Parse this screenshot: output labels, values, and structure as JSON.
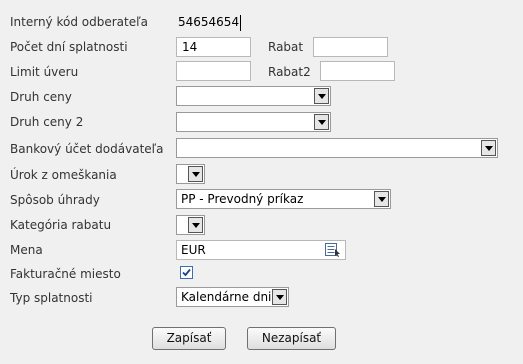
{
  "form": {
    "internal_code": {
      "label": "Interný kód odberateľa",
      "value": "54654654"
    },
    "due_days": {
      "label": "Počet dní splatnosti",
      "value": "14"
    },
    "discount": {
      "label": "Rabat",
      "value": ""
    },
    "credit_limit": {
      "label": "Limit úveru",
      "value": ""
    },
    "discount2": {
      "label": "Rabat2",
      "value": ""
    },
    "price_type": {
      "label": "Druh ceny",
      "value": ""
    },
    "price_type2": {
      "label": "Druh ceny 2",
      "value": ""
    },
    "supplier_account": {
      "label": "Bankový účet dodávateľa",
      "value": ""
    },
    "late_interest": {
      "label": "Úrok z omeškania",
      "value": ""
    },
    "payment_method": {
      "label": "Spôsob úhrady",
      "value": "PP - Prevodný príkaz"
    },
    "discount_category": {
      "label": "Kategória rabatu",
      "value": ""
    },
    "currency": {
      "label": "Mena",
      "value": "EUR",
      "icon": "calendar-list-icon"
    },
    "invoice_place": {
      "label": "Fakturačné miesto",
      "checked": true
    },
    "due_type": {
      "label": "Typ splatnosti",
      "value": "Kalendárne dni"
    }
  },
  "buttons": {
    "save": "Zapísať",
    "cancel": "Nezapísať"
  },
  "colors": {
    "background": "#f0f0f0",
    "input_border": "#b8b8b8",
    "checkbox_border": "#3c6fb0",
    "check_mark": "#1c3f8a"
  }
}
